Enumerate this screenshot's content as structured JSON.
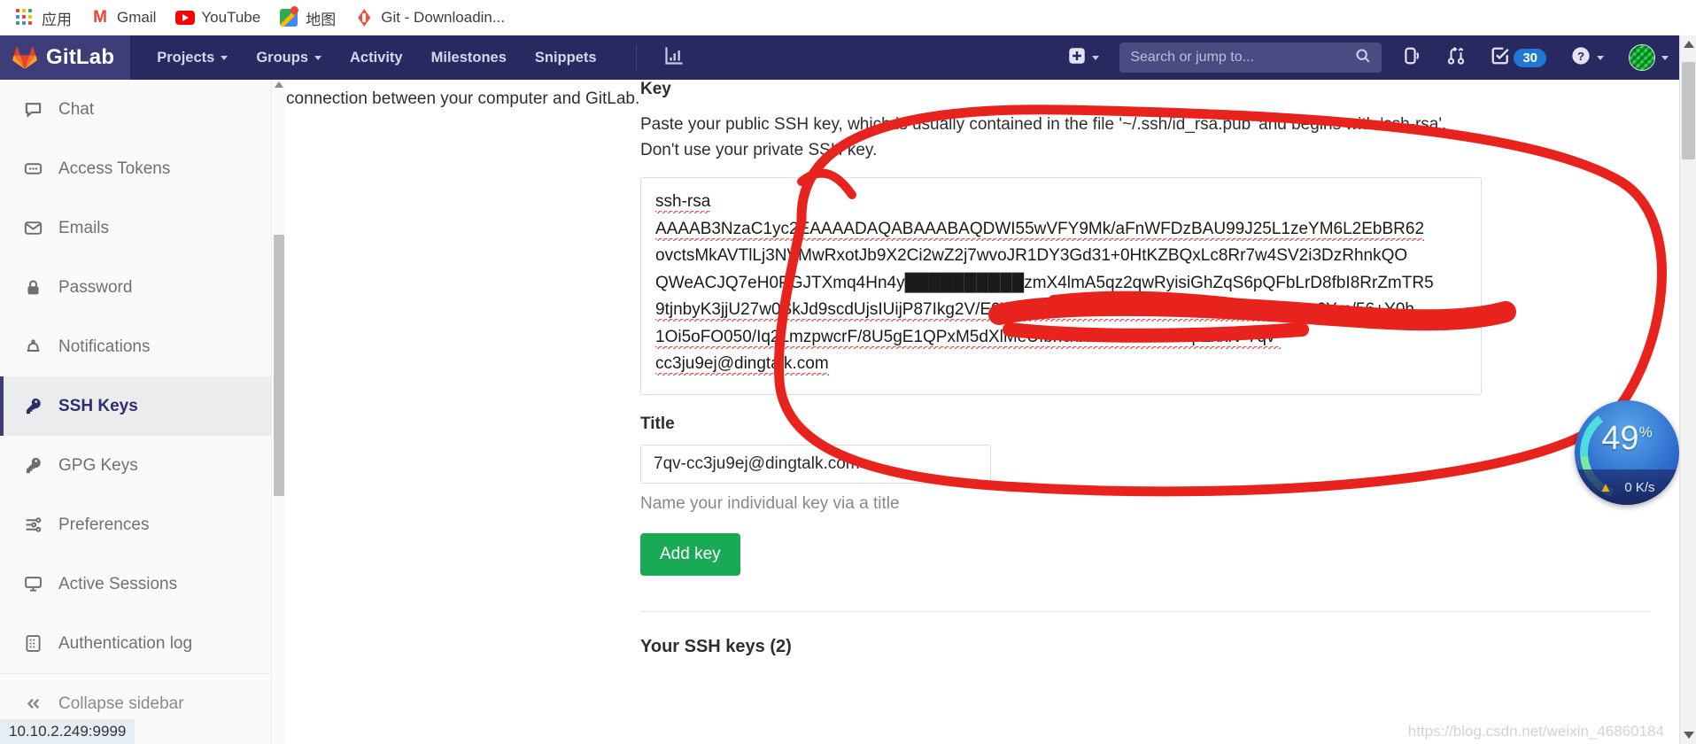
{
  "browser": {
    "bookmarks": [
      {
        "label": "应用",
        "icon": "apps-grid-icon"
      },
      {
        "label": "Gmail",
        "icon": "gmail-icon"
      },
      {
        "label": "YouTube",
        "icon": "youtube-icon"
      },
      {
        "label": "地图",
        "icon": "google-maps-icon"
      },
      {
        "label": "Git - Downloadin...",
        "icon": "git-icon"
      }
    ],
    "status_url": "10.10.2.249:9999",
    "watermark": "https://blog.csdn.net/weixin_46860184"
  },
  "navbar": {
    "brand": "GitLab",
    "brand_icon": "gitlab-tanuki-logo",
    "items": [
      {
        "label": "Projects",
        "has_caret": true
      },
      {
        "label": "Groups",
        "has_caret": true
      },
      {
        "label": "Activity",
        "has_caret": false
      },
      {
        "label": "Milestones",
        "has_caret": false
      },
      {
        "label": "Snippets",
        "has_caret": false
      }
    ],
    "analytics_icon": "chart-bar-icon",
    "new_icon": "plus-square-icon",
    "search": {
      "placeholder": "Search or jump to...",
      "icon": "search-icon"
    },
    "issues_icon": "issues-icon",
    "merge_requests_icon": "merge-request-icon",
    "todos_icon": "todo-check-icon",
    "todos_count": "30",
    "help_icon": "question-circle-icon",
    "avatar_icon": "user-avatar"
  },
  "sidebar": {
    "items": [
      {
        "label": "Chat",
        "icon": "chat-bubble-icon",
        "active": false
      },
      {
        "label": "Access Tokens",
        "icon": "token-icon",
        "active": false
      },
      {
        "label": "Emails",
        "icon": "envelope-icon",
        "active": false
      },
      {
        "label": "Password",
        "icon": "lock-icon",
        "active": false
      },
      {
        "label": "Notifications",
        "icon": "bell-icon",
        "active": false
      },
      {
        "label": "SSH Keys",
        "icon": "key-icon",
        "active": true
      },
      {
        "label": "GPG Keys",
        "icon": "key-icon",
        "active": false
      },
      {
        "label": "Preferences",
        "icon": "sliders-icon",
        "active": false
      },
      {
        "label": "Active Sessions",
        "icon": "monitor-icon",
        "active": false
      },
      {
        "label": "Authentication log",
        "icon": "list-grid-icon",
        "active": false
      }
    ],
    "collapse_label": "Collapse sidebar",
    "collapse_icon": "double-chevron-left-icon"
  },
  "main": {
    "intro_tail": "connection between your computer and GitLab.",
    "key_label": "Key",
    "key_help": "Paste your public SSH key, which is usually contained in the file '~/.ssh/id_rsa.pub' and begins with 'ssh-rsa'. Don't use your private SSH key.",
    "key_value_lines": [
      "ssh-rsa",
      "AAAAB3NzaC1yc2EAAAADAQABAAABAQDWI55wVFY9Mk/aFnWFDzBAU99J25L1zeYM6L2EbBR62",
      "ovctsMkAVTlLj3NVMwRxotJb9X2Ci2wZ2j7wvoJR1DY3Gd31+0HtKZBQxLc8Rr7w4SV2i3DzRhnkQO",
      "QWeACJQ7eH0PGJTXmq4Hn4y██████████zmX4lmA5qz2qwRyisiGhZqS6pQFbLrD8fbI8RrZmTR5",
      "9tjnbyK3jjU27w0SkJd9scdUjsIUijP87Ikg2V/E9V2sXnX1KeDmWEBIEMZbJhKu9BHsMnz6Ym/56+Y0h",
      "1Oi5oFO050/Iq2LmzpwcrF/8U5gE1QPxM5dXlMeUIbhc/bJYalJhAK11vnpZxxlV 7qv-",
      "cc3ju9ej@dingtalk.com"
    ],
    "title_label": "Title",
    "title_value": "7qv-cc3ju9ej@dingtalk.com",
    "title_help": "Name your individual key via a title",
    "add_key_label": "Add key",
    "your_keys_heading": "Your SSH keys (2)"
  },
  "speed_widget": {
    "percent": "49",
    "percent_unit": "%",
    "rate": "0 K/s",
    "arrow_icon": "upload-arrow-icon"
  },
  "colors": {
    "navbar_bg": "#292961",
    "accent_green": "#1aaa55",
    "annotation_red": "#e8221c",
    "todo_blue": "#1f78d1",
    "active_sidebar": "#2e2e6b"
  }
}
